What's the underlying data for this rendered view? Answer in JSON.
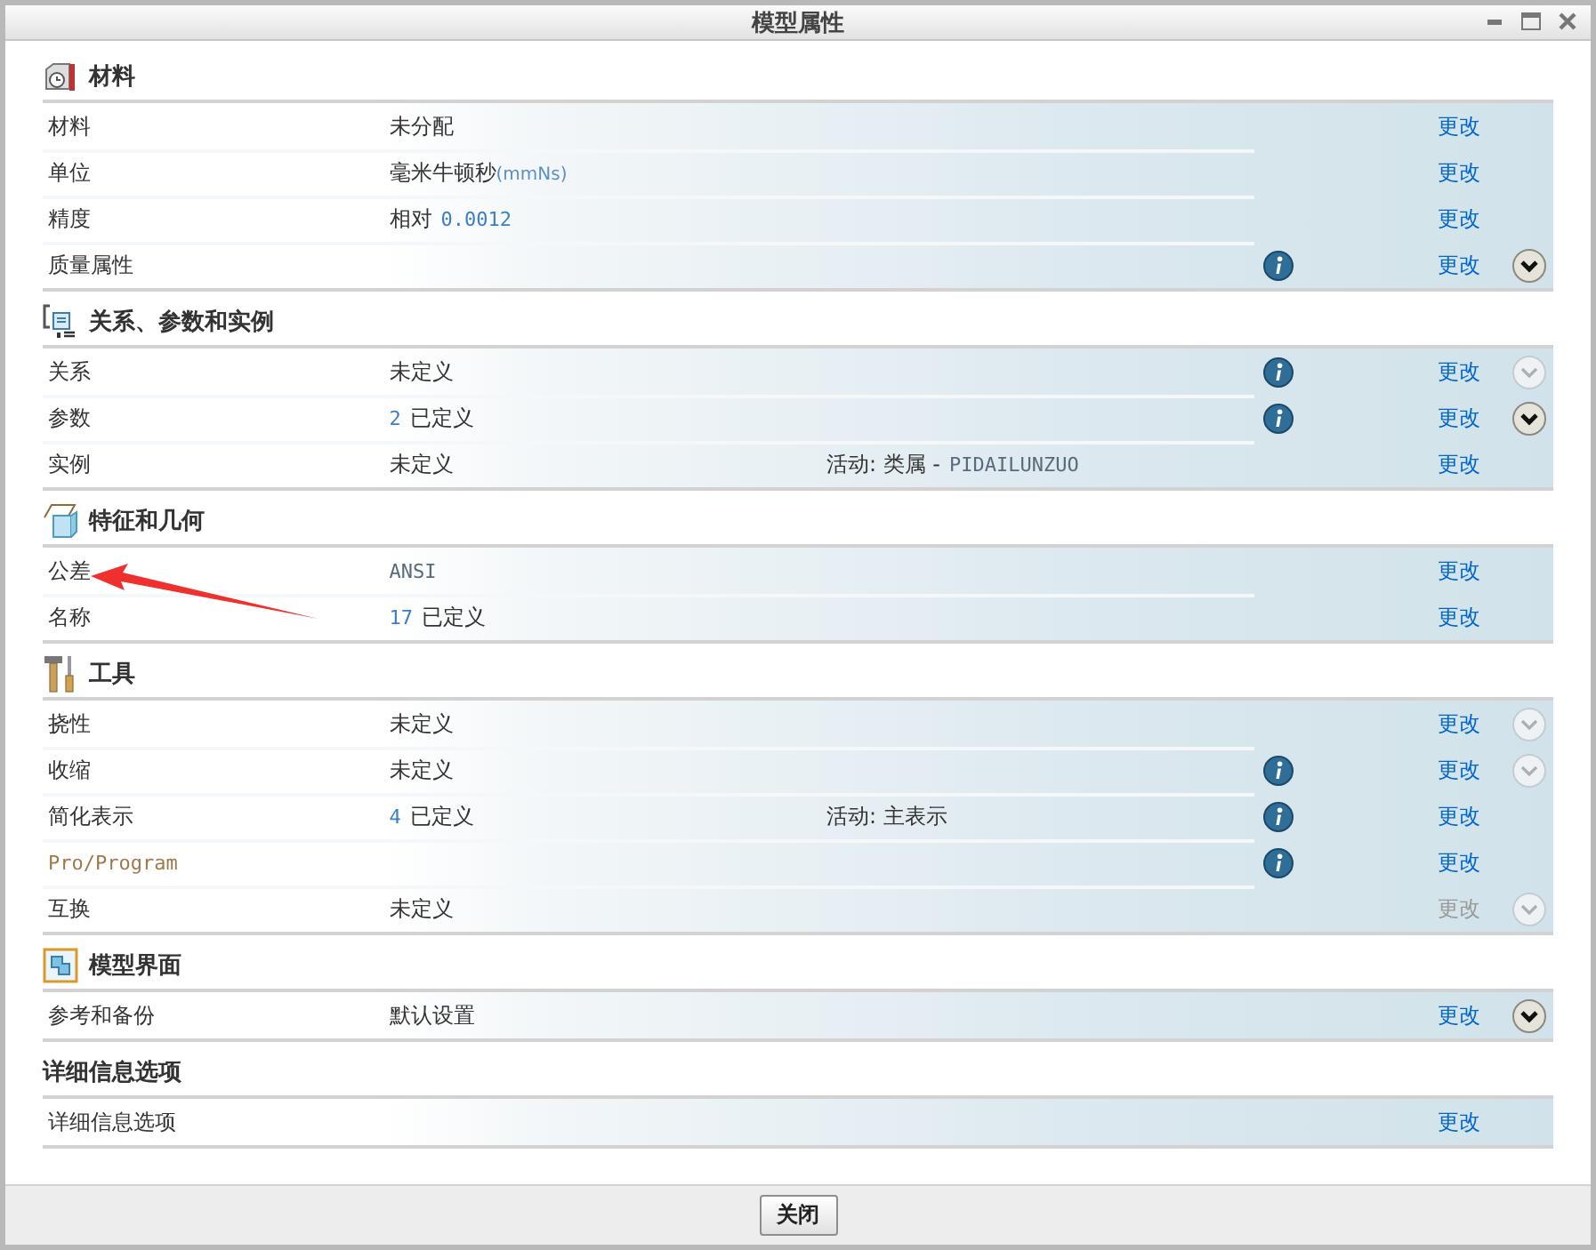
{
  "window": {
    "title": "模型属性"
  },
  "sections": [
    {
      "title": "材料",
      "kind": "material",
      "rows": [
        {
          "label": "材料",
          "code_label": false,
          "value": [
            {
              "kind": "text",
              "text": "未分配"
            }
          ],
          "info": false,
          "link": "更改",
          "link_disabled": false,
          "expander": false
        },
        {
          "label": "单位",
          "code_label": false,
          "value": [
            {
              "kind": "text",
              "text": "毫米牛顿秒"
            },
            {
              "kind": "unit",
              "text": "(mmNs)"
            }
          ],
          "info": false,
          "link": "更改",
          "link_disabled": false,
          "expander": false
        },
        {
          "label": "精度",
          "code_label": false,
          "value": [
            {
              "kind": "text",
              "text": "相对"
            },
            {
              "kind": "number",
              "text": "0.0012"
            }
          ],
          "info": false,
          "link": "更改",
          "link_disabled": false,
          "expander": false
        },
        {
          "label": "质量属性",
          "code_label": false,
          "value": [],
          "info": true,
          "link": "更改",
          "link_disabled": false,
          "expander": true,
          "expander_disabled": false
        }
      ]
    },
    {
      "title": "关系、参数和实例",
      "kind": "relations",
      "rows": [
        {
          "label": "关系",
          "code_label": false,
          "value": [
            {
              "kind": "text",
              "text": "未定义"
            }
          ],
          "info": true,
          "link": "更改",
          "link_disabled": false,
          "expander": true,
          "expander_disabled": true
        },
        {
          "label": "参数",
          "code_label": false,
          "value": [
            {
              "kind": "number",
              "text": "2"
            },
            {
              "kind": "text",
              "text": "已定义"
            }
          ],
          "info": true,
          "link": "更改",
          "link_disabled": false,
          "expander": true,
          "expander_disabled": false
        },
        {
          "label": "实例",
          "code_label": false,
          "value": [
            {
              "kind": "text",
              "text": "未定义"
            }
          ],
          "active": [
            {
              "kind": "text",
              "text": "活动: 类属 -"
            },
            {
              "kind": "code",
              "text": "PIDAILUNZUO"
            }
          ],
          "info": false,
          "link": "更改",
          "link_disabled": false,
          "expander": false
        }
      ]
    },
    {
      "title": "特征和几何",
      "kind": "features",
      "rows": [
        {
          "label": "公差",
          "code_label": false,
          "value": [
            {
              "kind": "code",
              "text": "ANSI"
            }
          ],
          "info": false,
          "link": "更改",
          "link_disabled": false,
          "expander": false
        },
        {
          "label": "名称",
          "code_label": false,
          "value": [
            {
              "kind": "number",
              "text": "17"
            },
            {
              "kind": "text",
              "text": "已定义"
            }
          ],
          "info": false,
          "link": "更改",
          "link_disabled": false,
          "expander": false
        }
      ]
    },
    {
      "title": "工具",
      "kind": "tools",
      "rows": [
        {
          "label": "挠性",
          "code_label": false,
          "value": [
            {
              "kind": "text",
              "text": "未定义"
            }
          ],
          "info": false,
          "link": "更改",
          "link_disabled": false,
          "expander": true,
          "expander_disabled": true
        },
        {
          "label": "收缩",
          "code_label": false,
          "value": [
            {
              "kind": "text",
              "text": "未定义"
            }
          ],
          "info": true,
          "link": "更改",
          "link_disabled": false,
          "expander": true,
          "expander_disabled": true
        },
        {
          "label": "简化表示",
          "code_label": false,
          "value": [
            {
              "kind": "number",
              "text": "4"
            },
            {
              "kind": "text",
              "text": "已定义"
            }
          ],
          "active": [
            {
              "kind": "text",
              "text": "活动: 主表示"
            }
          ],
          "info": true,
          "link": "更改",
          "link_disabled": false,
          "expander": false
        },
        {
          "label": "Pro/Program",
          "code_label": true,
          "value": [],
          "info": true,
          "link": "更改",
          "link_disabled": false,
          "expander": false
        },
        {
          "label": "互换",
          "code_label": false,
          "value": [
            {
              "kind": "text",
              "text": "未定义"
            }
          ],
          "info": false,
          "link": "更改",
          "link_disabled": true,
          "expander": true,
          "expander_disabled": true
        }
      ]
    },
    {
      "title": "模型界面",
      "kind": "interface",
      "rows": [
        {
          "label": "参考和备份",
          "code_label": false,
          "value": [
            {
              "kind": "text",
              "text": "默认设置"
            }
          ],
          "info": false,
          "link": "更改",
          "link_disabled": false,
          "expander": true,
          "expander_disabled": false
        }
      ]
    },
    {
      "title": "详细信息选项",
      "kind": "none",
      "rows": [
        {
          "label": "详细信息选项",
          "code_label": false,
          "value": [],
          "info": false,
          "link": "更改",
          "link_disabled": false,
          "expander": false
        }
      ]
    }
  ],
  "footer": {
    "button": "关闭"
  }
}
